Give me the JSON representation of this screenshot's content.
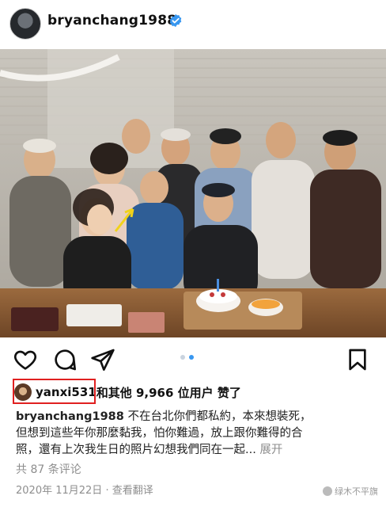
{
  "post": {
    "username": "bryanchang1988",
    "verified": true,
    "likes": {
      "first_liker": "yanxi531",
      "rest_text": "和其他 9,966 位用户 赞了"
    },
    "caption": {
      "username": "bryanchang1988",
      "line1": " 不在台北你們都私約，本來想裝死，",
      "line2": "但想到這些年你那麼黏我，怕你難過，放上跟你難得的合",
      "line3": "照，還有上次我生日的照片幻想我們同在一起...",
      "more": " 展开"
    },
    "comments_text": "共 87 条评论",
    "date": "2020年 11月22日",
    "separator": " · ",
    "translate": "查看翻译"
  },
  "watermark": "绿木不平旗",
  "icons": {
    "verified": "verified-badge-icon",
    "like": "heart-icon",
    "comment": "comment-icon",
    "share": "send-icon",
    "save": "bookmark-icon"
  },
  "colors": {
    "verified": "#3897f0",
    "highlight_box": "#e02020",
    "muted": "#8e8e8e"
  },
  "carousel": {
    "count": 2,
    "active": 2
  }
}
